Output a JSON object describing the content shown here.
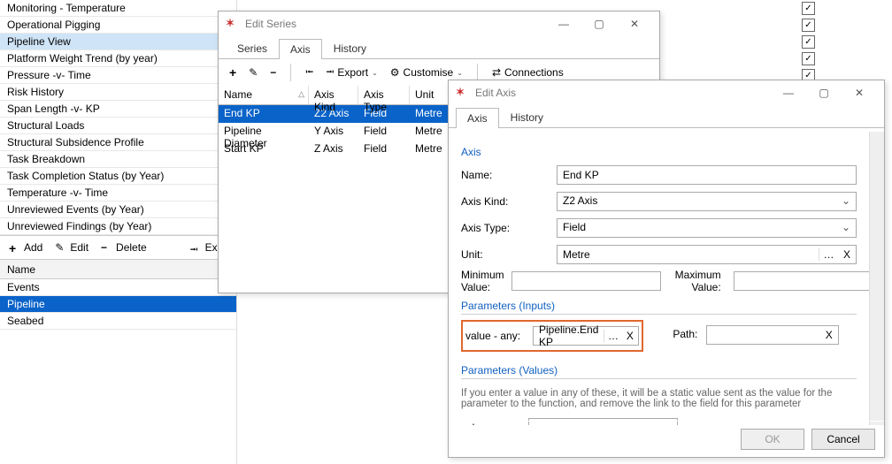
{
  "sidebar": {
    "items": [
      "Monitoring - Temperature",
      "Operational Pigging",
      "Pipeline View",
      "Platform Weight Trend (by year)",
      "Pressure -v- Time",
      "Risk History",
      "Span Length -v- KP",
      "Structural Loads",
      "Structural Subsidence Profile",
      "Task Breakdown",
      "Task Completion Status (by Year)",
      "Temperature -v- Time",
      "Unreviewed Events (by Year)",
      "Unreviewed Findings (by Year)"
    ],
    "selected_index": 2,
    "toolbar": {
      "add": "Add",
      "edit": "Edit",
      "delete": "Delete",
      "export": "Expor"
    },
    "header": "Name",
    "lower_items": [
      "Events",
      "Pipeline",
      "Seabed"
    ],
    "lower_selected_index": 1
  },
  "check_count": 5,
  "edit_series": {
    "title": "Edit Series",
    "tabs": [
      "Series",
      "Axis",
      "History"
    ],
    "active_tab": 1,
    "toolbar": {
      "export": "Export",
      "customise": "Customise",
      "connections": "Connections"
    },
    "grid": {
      "cols": [
        "Name",
        "Axis Kind",
        "Axis Type",
        "Unit"
      ],
      "rows": [
        {
          "name": "End KP",
          "kind": "Z2 Axis",
          "type": "Field",
          "unit": "Metre"
        },
        {
          "name": "Pipeline Diameter",
          "kind": "Y Axis",
          "type": "Field",
          "unit": "Metre"
        },
        {
          "name": "Start KP",
          "kind": "Z Axis",
          "type": "Field",
          "unit": "Metre"
        }
      ],
      "selected_index": 0
    }
  },
  "edit_axis": {
    "title": "Edit Axis",
    "tabs": [
      "Axis",
      "History"
    ],
    "active_tab": 0,
    "section_axis": "Axis",
    "name_label": "Name:",
    "name_value": "End KP",
    "kind_label": "Axis Kind:",
    "kind_value": "Z2 Axis",
    "type_label": "Axis Type:",
    "type_value": "Field",
    "unit_label": "Unit:",
    "unit_value": "Metre",
    "min_label": "Minimum Value:",
    "min_value": "",
    "max_label": "Maximum Value:",
    "max_value": "",
    "params_inputs": "Parameters (Inputs)",
    "value_any_label": "value - any:",
    "value_any_value": "Pipeline.End KP",
    "path_label": "Path:",
    "path_value": "",
    "params_values": "Parameters (Values)",
    "help_text": "If you enter a value in any of these, it will be a static value sent as the value for the parameter to the function, and remove the link to the field for this parameter",
    "value_any2_value": "",
    "ok": "OK",
    "cancel": "Cancel"
  }
}
